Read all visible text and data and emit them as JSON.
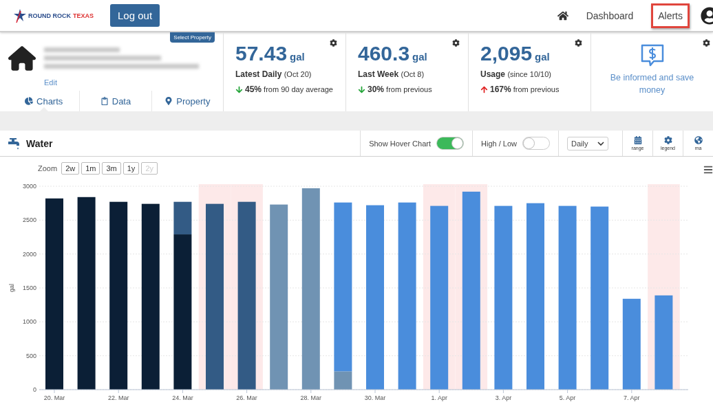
{
  "header": {
    "logo": {
      "text_1": "ROUND ROCK",
      "text_2": "TEXAS"
    },
    "logout": "Log out",
    "nav": [
      {
        "kind": "home"
      },
      {
        "kind": "link",
        "label": "Dashboard",
        "highlighted": false
      },
      {
        "kind": "link",
        "label": "Alerts",
        "highlighted": true
      },
      {
        "kind": "user"
      }
    ]
  },
  "property": {
    "select_button": "Select Property",
    "edit": "Edit",
    "tabs": [
      {
        "label": "Charts",
        "selected": true
      },
      {
        "label": "Data",
        "selected": false
      },
      {
        "label": "Property",
        "selected": false
      }
    ]
  },
  "cards": [
    {
      "value": "57.43",
      "unit": "gal",
      "label": "Latest Daily",
      "note": "(Oct 20)",
      "kind": "down",
      "change": "45%",
      "change_note": "from 90 day average"
    },
    {
      "value": "460.3",
      "unit": "gal",
      "label": "Last Week",
      "note": "(Oct 8)",
      "kind": "down",
      "change": "30%",
      "change_note": "from previous"
    },
    {
      "value": "2,095",
      "unit": "gal",
      "label": "Usage",
      "note": "(since 10/10)",
      "kind": "up",
      "change": "167%",
      "change_note": "from previous"
    }
  ],
  "promo": {
    "text": "Be informed and save money"
  },
  "toolbar": {
    "title": "Water",
    "toggles": [
      {
        "label": "Show Hover Chart",
        "on": true
      },
      {
        "label": "High / Low",
        "on": false
      }
    ],
    "interval": "Daily",
    "tools": [
      {
        "kind": "range",
        "label": "range"
      },
      {
        "kind": "legend",
        "label": "legend"
      },
      {
        "kind": "map",
        "label": "ma"
      }
    ]
  },
  "zoom": {
    "label": "Zoom",
    "buttons": [
      {
        "label": "2w",
        "disabled": false
      },
      {
        "label": "1m",
        "disabled": false
      },
      {
        "label": "3m",
        "disabled": false
      },
      {
        "label": "1y",
        "disabled": false
      },
      {
        "label": "2y",
        "disabled": true
      }
    ]
  },
  "chart_data": {
    "type": "bar",
    "ylabel": "gal",
    "stacked": true,
    "categories": [
      "20. Mar",
      null,
      "22. Mar",
      null,
      "24. Mar",
      null,
      "26. Mar",
      null,
      "28. Mar",
      null,
      "30. Mar",
      null,
      "1. Apr",
      null,
      "3. Apr",
      null,
      "5. Apr",
      null,
      "7. Apr",
      null
    ],
    "series": [
      {
        "color": "#0b1f36",
        "values": [
          2820,
          2840,
          2770,
          2740,
          2290,
          null,
          null,
          null,
          null,
          null,
          null,
          null,
          null,
          null,
          null,
          null,
          null,
          null,
          null,
          null
        ]
      },
      {
        "color": "#335b85",
        "values": [
          null,
          null,
          null,
          null,
          480,
          2740,
          2770,
          null,
          null,
          null,
          null,
          null,
          null,
          null,
          null,
          null,
          null,
          null,
          null,
          null
        ]
      },
      {
        "color": "#7093b3",
        "values": [
          null,
          null,
          null,
          null,
          null,
          null,
          null,
          2730,
          2970,
          270,
          null,
          null,
          null,
          null,
          null,
          null,
          null,
          null,
          null,
          null
        ]
      },
      {
        "color": "#4a8ddc",
        "values": [
          null,
          null,
          null,
          null,
          null,
          null,
          null,
          null,
          null,
          2490,
          2720,
          2760,
          2710,
          2920,
          2710,
          2750,
          2710,
          2700,
          1340,
          1390
        ]
      }
    ],
    "ylim": [
      0,
      3000
    ],
    "yticks": [
      0,
      500,
      1000,
      1500,
      2000,
      2500,
      3000
    ],
    "grid": true,
    "bands": [
      false,
      false,
      false,
      false,
      false,
      true,
      true,
      false,
      false,
      false,
      false,
      false,
      true,
      true,
      false,
      false,
      false,
      false,
      false,
      true
    ]
  }
}
